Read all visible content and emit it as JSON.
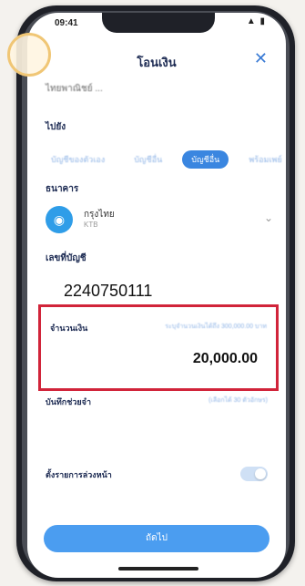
{
  "status": {
    "time": "09:41",
    "icons": "▲ ▮"
  },
  "header": {
    "title": "โอนเงิน",
    "close_icon": "close-icon"
  },
  "from": {
    "name": "ไทยพาณิชย์ ..."
  },
  "to_section": {
    "label": "ไปยัง",
    "tabs": [
      "บัญชีของตัวเอง",
      "บัญชีอื่น",
      "บัญชีอื่น",
      "พร้อมเพย์"
    ],
    "active_tab_index": 2
  },
  "bank": {
    "label": "ธนาคาร",
    "name": "กรุงไทย",
    "code": "KTB"
  },
  "account": {
    "label": "เลขที่บัญชี",
    "number": "2240750111"
  },
  "amount": {
    "label": "จำนวนเงิน",
    "limit_hint": "ระบุจำนวนเงินได้ถึง 300,000.00 บาท",
    "value": "20,000.00"
  },
  "note": {
    "label": "บันทึกช่วยจำ",
    "hint": "(เลือกได้ 30 ตัวอักษร)"
  },
  "schedule": {
    "label": "ตั้งรายการล่วงหน้า",
    "enabled": false
  },
  "footer": {
    "next_label": "ถัดไป"
  },
  "colors": {
    "accent": "#3a86e0",
    "highlight_border": "#d1243a"
  }
}
